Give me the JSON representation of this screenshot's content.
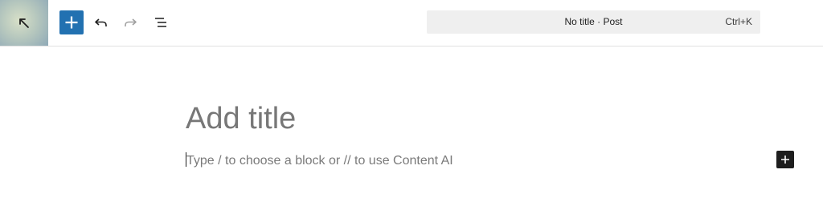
{
  "header": {
    "site_icon": "arrow-up-left-icon",
    "inserter_icon": "plus-icon",
    "undo_icon": "undo-icon",
    "redo_icon": "redo-icon",
    "list_view_icon": "list-view-icon",
    "command_bar": {
      "title": "No title · Post",
      "shortcut": "Ctrl+K"
    }
  },
  "editor": {
    "title_placeholder": "Add title",
    "block_placeholder": "Type / to choose a block or // to use Content AI",
    "block_inserter_icon": "plus-icon"
  },
  "colors": {
    "accent": "#2271b1",
    "dark": "#1e1e1e",
    "command_bg": "#efefef"
  }
}
